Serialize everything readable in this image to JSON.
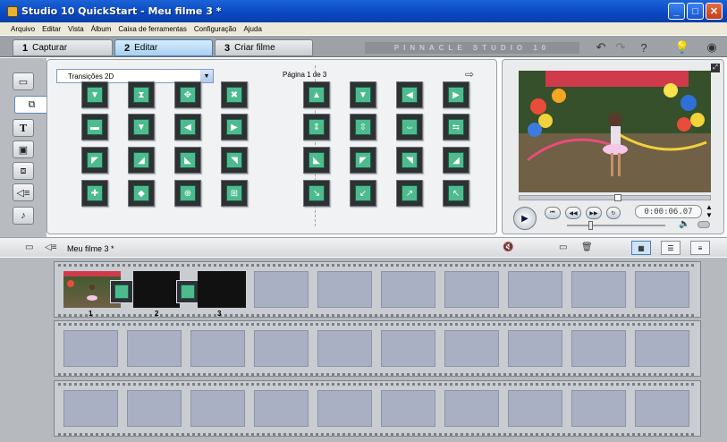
{
  "window": {
    "title": "Studio 10 QuickStart - Meu filme 3 *"
  },
  "menu": [
    "Arquivo",
    "Editar",
    "Vista",
    "Álbum",
    "Caixa de ferramentas",
    "Configuração",
    "Ajuda"
  ],
  "tabs": [
    {
      "num": "1",
      "label": "Capturar"
    },
    {
      "num": "2",
      "label": "Editar"
    },
    {
      "num": "3",
      "label": "Criar filme"
    }
  ],
  "active_tab": "Editar",
  "brand": "PINNACLE STUDIO 10",
  "album": {
    "dropdown_value": "Transições 2D",
    "page_label": "Página 1 de 3",
    "left_glyphs": [
      "▼",
      "⧗",
      "✥",
      "✖",
      "▬",
      "▼",
      "◀",
      "▶",
      "◤",
      "◢",
      "◣",
      "◥",
      "✚",
      "◆",
      "⊕",
      "⊞"
    ],
    "right_glyphs": [
      "▲",
      "▼",
      "◀",
      "▶",
      "⇕",
      "⇳",
      "⇔",
      "⇆",
      "◣",
      "◤",
      "◥",
      "◢",
      "↘",
      "↙",
      "↗",
      "↖"
    ]
  },
  "player": {
    "timecode": "0:00:06.07"
  },
  "movie": {
    "title": "Meu filme 3 *",
    "clips": [
      "1",
      "2",
      "3"
    ]
  }
}
